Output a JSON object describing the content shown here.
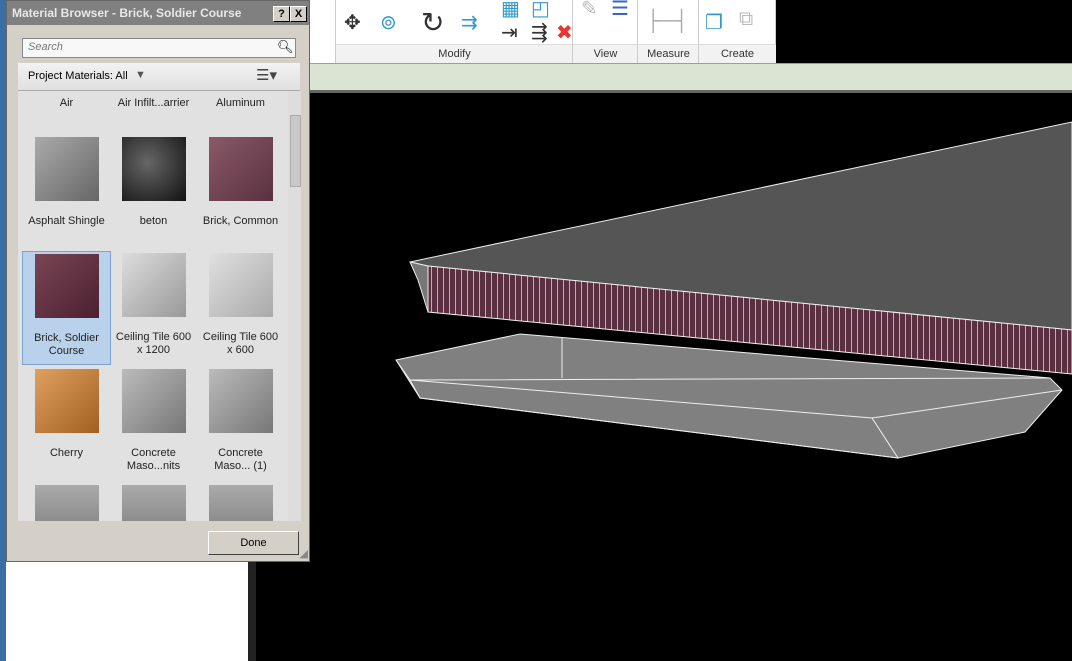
{
  "dialog": {
    "title": "Material Browser - Brick, Soldier Course",
    "help": "?",
    "close": "X",
    "search_placeholder": "Search",
    "filter": "Project Materials: All",
    "done": "Done",
    "selected": "Brick, Soldier Course",
    "materials": [
      {
        "name": "Air",
        "thumb": ""
      },
      {
        "name": "Air Infilt...arrier",
        "thumb": ""
      },
      {
        "name": "Aluminum",
        "thumb": ""
      },
      {
        "name": "Asphalt Shingle",
        "thumb": "linear-gradient(135deg,#aaa,#666)"
      },
      {
        "name": "beton",
        "thumb": "radial-gradient(circle at 40% 40%,#666,#111)"
      },
      {
        "name": "Brick, Common",
        "thumb": "linear-gradient(135deg,#8a5a68,#5a3040)"
      },
      {
        "name": "Brick, Soldier Course",
        "thumb": "linear-gradient(135deg,#7a4555,#4a2030)"
      },
      {
        "name": "Ceiling Tile 600 x 1200",
        "thumb": "linear-gradient(135deg,#ddd,#999)"
      },
      {
        "name": "Ceiling Tile 600 x 600",
        "thumb": "linear-gradient(135deg,#e0e0e0,#aaa)"
      },
      {
        "name": "Cherry",
        "thumb": "linear-gradient(135deg,#e0a060,#a06020)"
      },
      {
        "name": "Concrete Maso...nits",
        "thumb": "linear-gradient(135deg,#bbb,#777)"
      },
      {
        "name": "Concrete Maso... (1)",
        "thumb": "linear-gradient(135deg,#bbb,#777)"
      },
      {
        "name": "",
        "thumb": "linear-gradient(#aaa,#777)"
      },
      {
        "name": "",
        "thumb": "linear-gradient(#aaa,#777)"
      },
      {
        "name": "",
        "thumb": "linear-gradient(#aaa,#777)"
      }
    ]
  },
  "ribbon": {
    "panels": [
      "Modify",
      "View",
      "Measure",
      "Create"
    ]
  }
}
